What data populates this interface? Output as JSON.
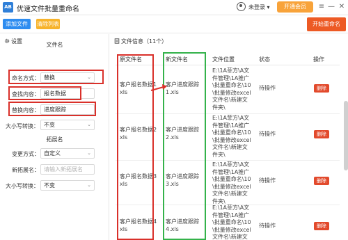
{
  "window": {
    "title": "优速文件批量重命名",
    "logo_text": "AB",
    "login_text": "未登录",
    "login_caret": "▾",
    "vip_label": "开通会员",
    "menu_glyph": "≡",
    "minimize_glyph": "—",
    "close_glyph": "✕"
  },
  "toolbar": {
    "add_label": "添加文件",
    "clear_label": "清除列表",
    "start_label": "开始重命名"
  },
  "settings": {
    "header": "设置",
    "filename_section": "文件名",
    "naming_mode_label": "命名方式：",
    "naming_mode_value": "替换",
    "find_label": "查找内容：",
    "find_value": "报名数据",
    "replace_label": "替换内容：",
    "replace_value": "进度跟踪",
    "case_label": "大小写转换：",
    "case_value": "不变",
    "ext_section": "拓展名",
    "change_mode_label": "变更方式：",
    "change_mode_value": "自定义",
    "new_ext_label": "新拓展名：",
    "new_ext_placeholder": "请输入新拓展名",
    "ext_case_label": "大小写转换：",
    "ext_case_value": "不变"
  },
  "file_list": {
    "header": "文件信息（11个）",
    "columns": [
      "原文件名",
      "新文件名",
      "文件位置",
      "状态",
      "操作"
    ],
    "rows": [
      {
        "original": [
          "客户报名数据1",
          "xls"
        ],
        "new_name": [
          "客户进度跟踪",
          "1.xls"
        ],
        "location": [
          "E:\\1A菲方\\A文",
          "件管理\\1A推广",
          "\\批量重命名\\10",
          "\\批量修改excel",
          "文件名\\新建文",
          "件夹\\"
        ],
        "status": "待操作",
        "action": "删除"
      },
      {
        "original": [
          "客户报名数据2",
          "xls"
        ],
        "new_name": [
          "客户进度跟踪",
          "2.xls"
        ],
        "location": [
          "E:\\1A菲方\\A文",
          "件管理\\1A推广",
          "\\批量重命名\\10",
          "\\批量修改excel",
          "文件名\\新建文",
          "件夹\\"
        ],
        "status": "待操作",
        "action": "删除"
      },
      {
        "original": [
          "客户报名数据3",
          "xls"
        ],
        "new_name": [
          "客户进度跟踪",
          "3.xls"
        ],
        "location": [
          "E:\\1A菲方\\A文",
          "件管理\\1A推广",
          "\\批量重命名\\10",
          "\\批量修改excel",
          "文件名\\新建文",
          "件夹\\"
        ],
        "status": "待操作",
        "action": "删除"
      },
      {
        "original": [
          "客户报名数据4",
          "xls"
        ],
        "new_name": [
          "客户进度跟踪",
          "4.xls"
        ],
        "location": [
          "E:\\1A菲方\\A文",
          "件管理\\1A推广",
          "\\批量重命名\\10",
          "\\批量修改excel",
          "文件名\\新建文"
        ],
        "status": "待操作",
        "action": "删除"
      }
    ]
  },
  "colors": {
    "primary": "#2d8cf0",
    "clear": "#f7b32b",
    "start": "#ed5a24",
    "delete": "#e24a2c",
    "vip": "#f8a33a",
    "highlight_red": "#d9302a",
    "highlight_green": "#34b24a"
  }
}
